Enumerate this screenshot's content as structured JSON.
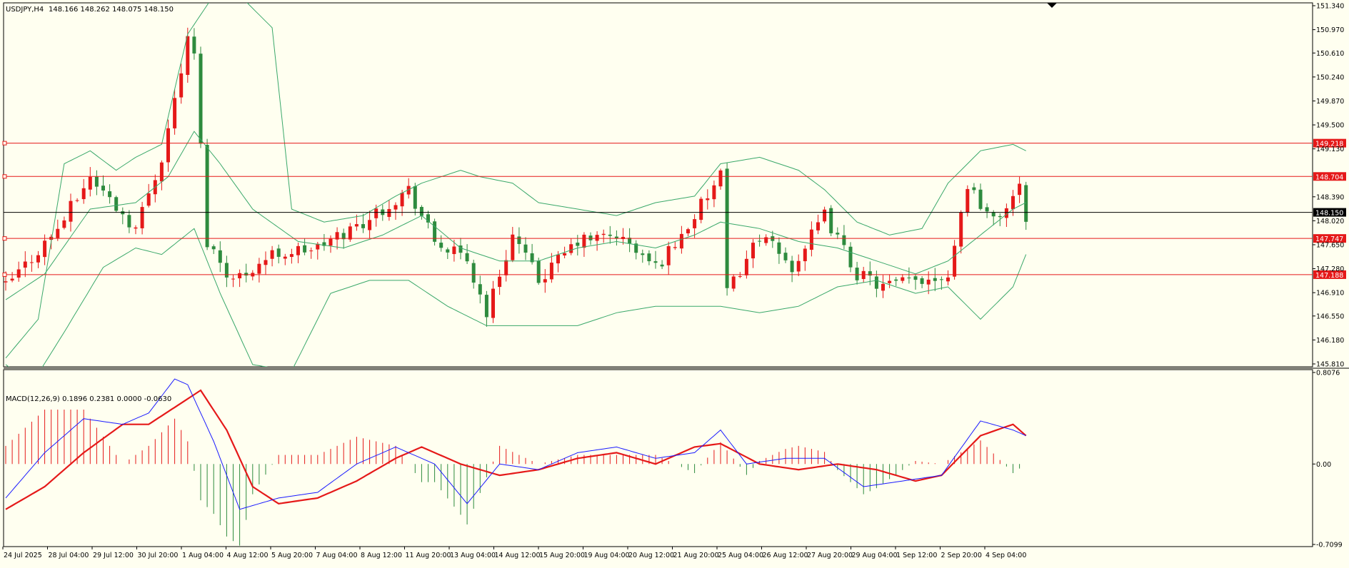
{
  "header": {
    "symbol": "USDJPY,H4",
    "ohlc": "148.166 148.262 148.075 148.150"
  },
  "macd_label": "MACD(12,26,9) 0.1896 0.2381 0.0000 -0.0630",
  "colors": {
    "background": "#fffff0",
    "bull": "#e51919",
    "bear": "#2e8b3e",
    "bands": "#3aa86a",
    "level": "#e51919",
    "macd": "#1a1aff",
    "signal": "#e51919"
  },
  "chart_data": [
    {
      "type": "candlestick",
      "name": "price",
      "x_labels": [
        "24 Jul 2025",
        "28 Jul 04:00",
        "29 Jul 12:00",
        "30 Jul 20:00",
        "1 Aug 04:00",
        "4 Aug 12:00",
        "5 Aug 20:00",
        "7 Aug 04:00",
        "8 Aug 12:00",
        "11 Aug 20:00",
        "13 Aug 04:00",
        "14 Aug 12:00",
        "15 Aug 20:00",
        "19 Aug 04:00",
        "20 Aug 12:00",
        "21 Aug 20:00",
        "25 Aug 04:00",
        "26 Aug 12:00",
        "27 Aug 20:00",
        "29 Aug 04:00",
        "1 Sep 12:00",
        "2 Sep 20:00",
        "4 Sep 04:00"
      ],
      "y_ticks": [
        "151.340",
        "150.970",
        "150.610",
        "150.240",
        "149.870",
        "149.500",
        "149.130",
        "148.390",
        "148.020",
        "147.650",
        "147.280",
        "146.910",
        "146.550",
        "146.180",
        "145.810"
      ],
      "ylim": [
        145.81,
        151.34
      ],
      "levels": [
        {
          "value": 149.218,
          "label": "149.218",
          "kind": "resistance"
        },
        {
          "value": 148.704,
          "label": "148.704",
          "kind": "resistance"
        },
        {
          "value": 148.15,
          "label": "148.150",
          "kind": "current"
        },
        {
          "value": 147.747,
          "label": "147.747",
          "kind": "support"
        },
        {
          "value": 147.188,
          "label": "147.188",
          "kind": "support"
        }
      ],
      "close_path": [
        [
          0,
          147.0
        ],
        [
          8,
          147.9
        ],
        [
          13,
          148.7
        ],
        [
          20,
          147.9
        ],
        [
          24,
          149.0
        ],
        [
          28,
          150.8
        ],
        [
          29,
          150.6
        ],
        [
          31,
          147.7
        ],
        [
          35,
          147.1
        ],
        [
          41,
          147.5
        ],
        [
          48,
          147.6
        ],
        [
          55,
          148.0
        ],
        [
          62,
          148.5
        ],
        [
          66,
          147.7
        ],
        [
          71,
          147.4
        ],
        [
          74,
          146.6
        ],
        [
          78,
          147.8
        ],
        [
          82,
          147.1
        ],
        [
          88,
          147.7
        ],
        [
          94,
          147.8
        ],
        [
          100,
          147.3
        ],
        [
          104,
          147.8
        ],
        [
          110,
          148.7
        ],
        [
          111,
          146.9
        ],
        [
          116,
          147.8
        ],
        [
          121,
          147.3
        ],
        [
          126,
          148.1
        ],
        [
          131,
          147.2
        ],
        [
          135,
          147.0
        ],
        [
          140,
          147.1
        ],
        [
          145,
          147.2
        ],
        [
          148,
          148.6
        ],
        [
          152,
          148.0
        ],
        [
          156,
          148.5
        ],
        [
          157,
          148.1
        ]
      ],
      "bollinger": {
        "upper": [
          [
            0,
            145.9
          ],
          [
            5,
            146.5
          ],
          [
            9,
            148.9
          ],
          [
            13,
            149.1
          ],
          [
            17,
            148.8
          ],
          [
            20,
            149.0
          ],
          [
            24,
            149.2
          ],
          [
            28,
            150.9
          ],
          [
            32,
            151.5
          ],
          [
            36,
            151.5
          ],
          [
            41,
            151.0
          ],
          [
            44,
            148.2
          ],
          [
            49,
            148.0
          ],
          [
            55,
            148.1
          ],
          [
            60,
            148.4
          ],
          [
            64,
            148.6
          ],
          [
            70,
            148.8
          ],
          [
            73,
            148.7
          ],
          [
            78,
            148.6
          ],
          [
            82,
            148.3
          ],
          [
            88,
            148.2
          ],
          [
            94,
            148.1
          ],
          [
            100,
            148.3
          ],
          [
            106,
            148.4
          ],
          [
            110,
            148.9
          ],
          [
            116,
            149.0
          ],
          [
            122,
            148.8
          ],
          [
            126,
            148.5
          ],
          [
            131,
            148.0
          ],
          [
            136,
            147.8
          ],
          [
            141,
            147.9
          ],
          [
            145,
            148.6
          ],
          [
            150,
            149.1
          ],
          [
            155,
            149.2
          ],
          [
            157,
            149.1
          ]
        ],
        "middle": [
          [
            0,
            146.8
          ],
          [
            6,
            147.2
          ],
          [
            13,
            148.2
          ],
          [
            20,
            148.3
          ],
          [
            25,
            148.7
          ],
          [
            29,
            149.4
          ],
          [
            33,
            148.9
          ],
          [
            38,
            148.2
          ],
          [
            45,
            147.7
          ],
          [
            52,
            147.6
          ],
          [
            58,
            147.8
          ],
          [
            64,
            148.1
          ],
          [
            70,
            147.6
          ],
          [
            76,
            147.4
          ],
          [
            82,
            147.4
          ],
          [
            88,
            147.6
          ],
          [
            94,
            147.7
          ],
          [
            100,
            147.6
          ],
          [
            106,
            147.8
          ],
          [
            110,
            148.0
          ],
          [
            116,
            147.9
          ],
          [
            122,
            147.7
          ],
          [
            128,
            147.6
          ],
          [
            134,
            147.4
          ],
          [
            140,
            147.2
          ],
          [
            145,
            147.4
          ],
          [
            150,
            147.8
          ],
          [
            155,
            148.2
          ],
          [
            157,
            148.3
          ]
        ],
        "lower": [
          [
            0,
            145.8
          ],
          [
            4,
            145.5
          ],
          [
            9,
            146.3
          ],
          [
            15,
            147.3
          ],
          [
            20,
            147.6
          ],
          [
            24,
            147.5
          ],
          [
            29,
            147.9
          ],
          [
            33,
            146.9
          ],
          [
            38,
            145.8
          ],
          [
            44,
            145.7
          ],
          [
            50,
            146.9
          ],
          [
            56,
            147.1
          ],
          [
            62,
            147.1
          ],
          [
            68,
            146.7
          ],
          [
            74,
            146.4
          ],
          [
            80,
            146.4
          ],
          [
            88,
            146.4
          ],
          [
            94,
            146.6
          ],
          [
            100,
            146.7
          ],
          [
            106,
            146.7
          ],
          [
            110,
            146.7
          ],
          [
            116,
            146.6
          ],
          [
            122,
            146.7
          ],
          [
            128,
            147.0
          ],
          [
            134,
            147.1
          ],
          [
            140,
            146.9
          ],
          [
            145,
            147.0
          ],
          [
            150,
            146.5
          ],
          [
            155,
            147.0
          ],
          [
            157,
            147.5
          ]
        ]
      }
    },
    {
      "type": "macd",
      "name": "macd",
      "y_ticks": [
        "0.8076",
        "0.00",
        "-0.7099"
      ],
      "ylim": [
        -0.7099,
        0.8076
      ],
      "values": {
        "main": 0.1896,
        "signal": 0.2381,
        "hist": 0.0
      },
      "main": [
        [
          0,
          -0.3
        ],
        [
          6,
          0.1
        ],
        [
          12,
          0.4
        ],
        [
          18,
          0.35
        ],
        [
          22,
          0.45
        ],
        [
          26,
          0.75
        ],
        [
          28,
          0.7
        ],
        [
          32,
          0.2
        ],
        [
          36,
          -0.4
        ],
        [
          42,
          -0.3
        ],
        [
          48,
          -0.25
        ],
        [
          54,
          0.0
        ],
        [
          60,
          0.15
        ],
        [
          66,
          0.0
        ],
        [
          71,
          -0.35
        ],
        [
          76,
          0.0
        ],
        [
          82,
          -0.05
        ],
        [
          88,
          0.1
        ],
        [
          94,
          0.15
        ],
        [
          100,
          0.05
        ],
        [
          106,
          0.1
        ],
        [
          110,
          0.3
        ],
        [
          114,
          0.0
        ],
        [
          120,
          0.05
        ],
        [
          126,
          0.05
        ],
        [
          132,
          -0.2
        ],
        [
          138,
          -0.15
        ],
        [
          144,
          -0.1
        ],
        [
          150,
          0.38
        ],
        [
          155,
          0.3
        ],
        [
          157,
          0.25
        ]
      ],
      "signal": [
        [
          0,
          -0.4
        ],
        [
          6,
          -0.2
        ],
        [
          12,
          0.1
        ],
        [
          18,
          0.35
        ],
        [
          22,
          0.35
        ],
        [
          26,
          0.5
        ],
        [
          30,
          0.65
        ],
        [
          34,
          0.3
        ],
        [
          38,
          -0.2
        ],
        [
          42,
          -0.35
        ],
        [
          48,
          -0.3
        ],
        [
          54,
          -0.15
        ],
        [
          60,
          0.05
        ],
        [
          64,
          0.15
        ],
        [
          70,
          0.0
        ],
        [
          76,
          -0.1
        ],
        [
          82,
          -0.05
        ],
        [
          88,
          0.05
        ],
        [
          94,
          0.1
        ],
        [
          100,
          0.0
        ],
        [
          106,
          0.15
        ],
        [
          110,
          0.18
        ],
        [
          116,
          0.0
        ],
        [
          122,
          -0.05
        ],
        [
          128,
          0.0
        ],
        [
          134,
          -0.05
        ],
        [
          140,
          -0.15
        ],
        [
          144,
          -0.1
        ],
        [
          150,
          0.25
        ],
        [
          155,
          0.35
        ],
        [
          157,
          0.25
        ]
      ]
    }
  ]
}
